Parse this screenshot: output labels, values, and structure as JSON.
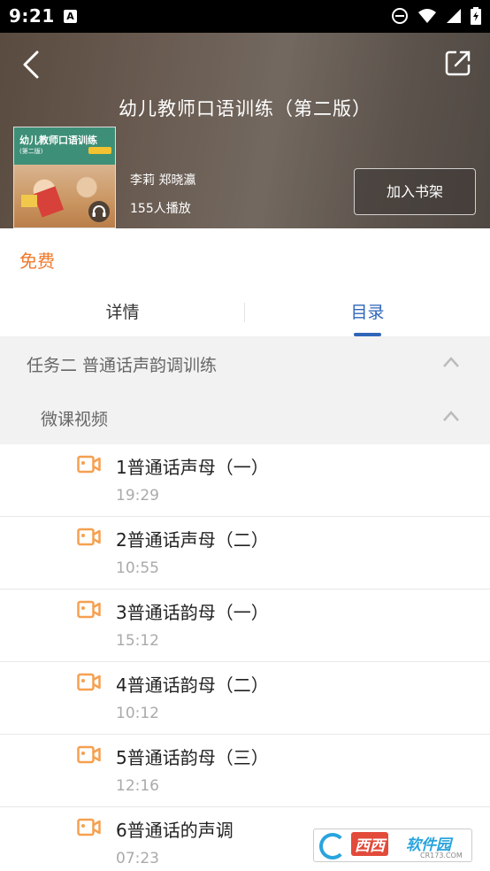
{
  "status_bar": {
    "time": "9:21",
    "notif": "A"
  },
  "header": {
    "title": "幼儿教师口语训练（第二版）"
  },
  "book": {
    "cover_title": "幼儿教师口语训练",
    "cover_edition": "(第二版)",
    "authors": "李莉 郑晓瀛",
    "plays": "155人播放",
    "shelf_button": "加入书架"
  },
  "price_label": "免费",
  "tabs": [
    {
      "label": "详情",
      "active": false
    },
    {
      "label": "目录",
      "active": true
    }
  ],
  "catalog": {
    "section": "任务二 普通话声韵调训练",
    "subsection": "微课视频",
    "items": [
      {
        "title": "1普通话声母（一）",
        "duration": "19:29"
      },
      {
        "title": "2普通话声母（二）",
        "duration": "10:55"
      },
      {
        "title": "3普通话韵母（一）",
        "duration": "15:12"
      },
      {
        "title": "4普通话韵母（二）",
        "duration": "10:12"
      },
      {
        "title": "5普通话韵母（三）",
        "duration": "12:16"
      },
      {
        "title": "6普通话的声调",
        "duration": "07:23"
      }
    ]
  },
  "watermark": {
    "text1": "西西",
    "text2": "软件园",
    "url": "CR173.COM"
  },
  "colors": {
    "accent": "#2e66b9",
    "orange": "#f07a2c",
    "video_icon": "#f5a050"
  }
}
